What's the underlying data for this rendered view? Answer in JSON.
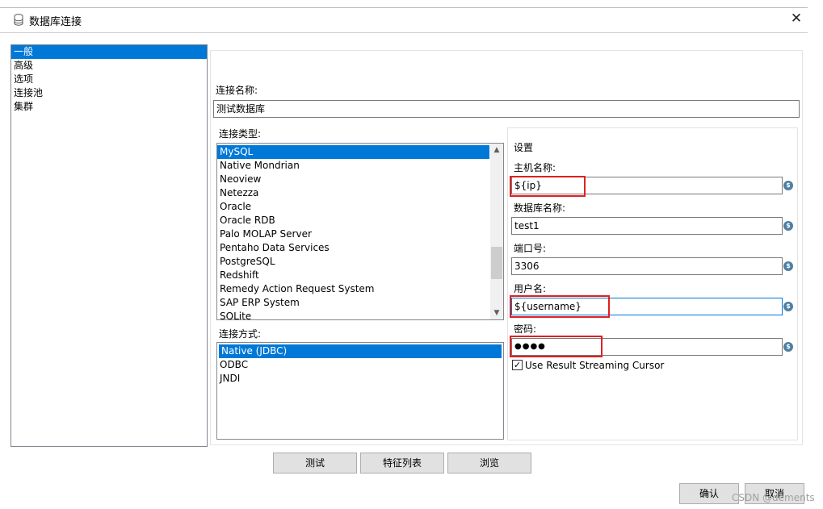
{
  "window": {
    "title": "数据库连接",
    "close_glyph": "✕"
  },
  "nav": {
    "items": [
      {
        "label": "一般",
        "selected": true
      },
      {
        "label": "高级"
      },
      {
        "label": "选项"
      },
      {
        "label": "连接池"
      },
      {
        "label": "集群"
      }
    ]
  },
  "connection_name": {
    "label": "连接名称:",
    "value": "测试数据库"
  },
  "connection_type": {
    "label": "连接类型:",
    "items": [
      "MySQL",
      "Native Mondrian",
      "Neoview",
      "Netezza",
      "Oracle",
      "Oracle RDB",
      "Palo MOLAP Server",
      "Pentaho Data Services",
      "PostgreSQL",
      "Redshift",
      "Remedy Action Request System",
      "SAP ERP System",
      "SQLite"
    ],
    "selected": "MySQL"
  },
  "access_method": {
    "label": "连接方式:",
    "items": [
      "Native (JDBC)",
      "ODBC",
      "JNDI"
    ],
    "selected": "Native (JDBC)"
  },
  "settings": {
    "title": "设置",
    "host": {
      "label": "主机名称:",
      "value": "${ip}"
    },
    "database": {
      "label": "数据库名称:",
      "value": "test1"
    },
    "port": {
      "label": "端口号:",
      "value": "3306"
    },
    "username": {
      "label": "用户名:",
      "value": "${username}"
    },
    "password": {
      "label": "密码:",
      "value": "●●●●"
    },
    "variable_icon_glyph": "$",
    "streaming_cursor": {
      "label": "Use Result Streaming Cursor",
      "checked": true,
      "check_glyph": "✓"
    }
  },
  "buttons": {
    "test": "测试",
    "feature_list": "特征列表",
    "browse": "浏览",
    "ok": "确认",
    "cancel": "取消"
  },
  "watermark": "CSDN @dements",
  "colors": {
    "selection": "#0078d7",
    "highlight_box": "#e02020",
    "variable_icon": "#4e7fa3"
  }
}
